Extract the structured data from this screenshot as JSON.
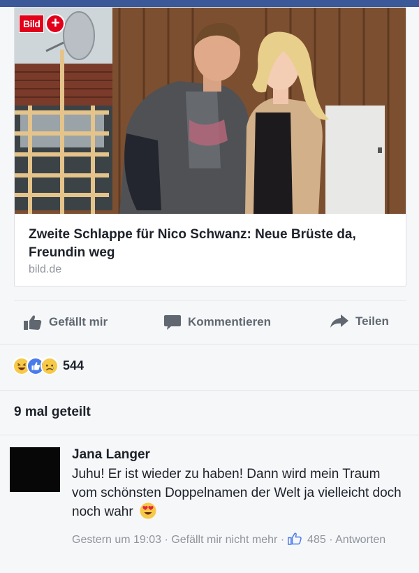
{
  "post": {
    "brand_logo": "Bild",
    "brand_plus": "+",
    "headline": "Zweite Schlappe für Nico Schwanz: Neue Brüste da, Freundin weg",
    "domain": "bild.de",
    "brand_color": "#e2001a"
  },
  "actions": {
    "like": "Gefällt mir",
    "comment": "Kommentieren",
    "share": "Teilen"
  },
  "reactions": {
    "types": [
      "haha-icon",
      "like-icon",
      "sad-icon"
    ],
    "count": "544"
  },
  "shares": {
    "label": "9 mal geteilt"
  },
  "comment": {
    "author": "Jana Langer",
    "text": "Juhu! Er ist wieder zu haben! Dann wird mein Traum vom schönsten Doppelnamen der Welt ja vielleicht doch noch wahr",
    "emoji": "heart-eyes-icon",
    "time": "Gestern um 19:03",
    "sep": "·",
    "unlike": "Gefällt mir nicht mehr",
    "likes": "485",
    "reply": "Antworten"
  },
  "colors": {
    "facebook_blue": "#3b5998",
    "muted_text": "#90949c",
    "action_text": "#606770"
  }
}
